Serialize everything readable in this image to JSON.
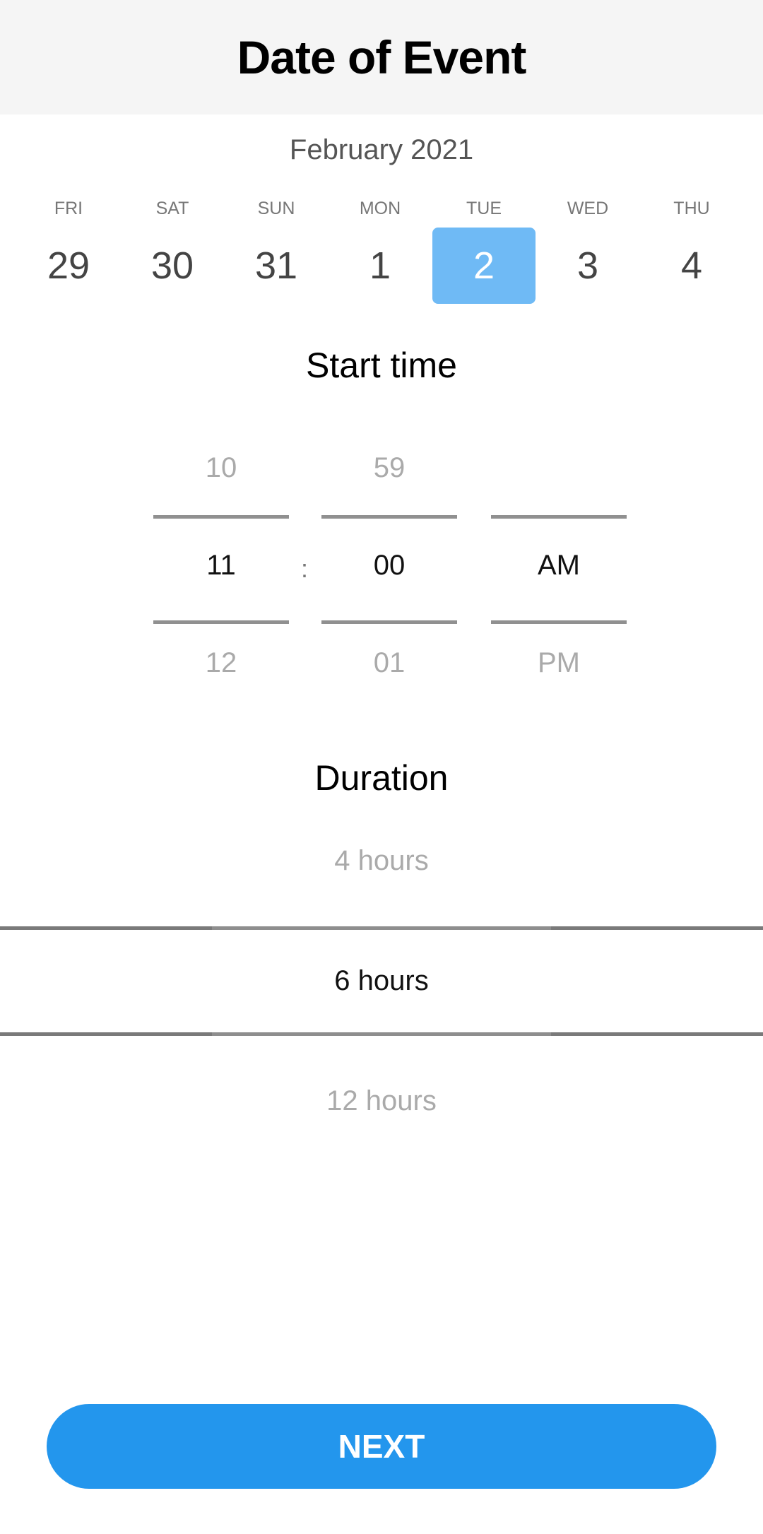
{
  "header": {
    "title": "Date of Event"
  },
  "calendar": {
    "month_label": "February 2021",
    "days": [
      {
        "dow": "FRI",
        "num": "29",
        "selected": false
      },
      {
        "dow": "SAT",
        "num": "30",
        "selected": false
      },
      {
        "dow": "SUN",
        "num": "31",
        "selected": false
      },
      {
        "dow": "MON",
        "num": "1",
        "selected": false
      },
      {
        "dow": "TUE",
        "num": "2",
        "selected": true
      },
      {
        "dow": "WED",
        "num": "3",
        "selected": false
      },
      {
        "dow": "THU",
        "num": "4",
        "selected": false
      }
    ],
    "selected_color": "#6fbaf5"
  },
  "start_time": {
    "title": "Start time",
    "separator": ":",
    "hour": {
      "prev": "10",
      "current": "11",
      "next": "12"
    },
    "minute": {
      "prev": "59",
      "current": "00",
      "next": "01"
    },
    "period": {
      "prev": "",
      "current": "AM",
      "next": "PM"
    }
  },
  "duration": {
    "title": "Duration",
    "prev": "4 hours",
    "current": "6 hours",
    "next": "12 hours"
  },
  "footer": {
    "next_label": "NEXT",
    "button_color": "#2396ed"
  }
}
